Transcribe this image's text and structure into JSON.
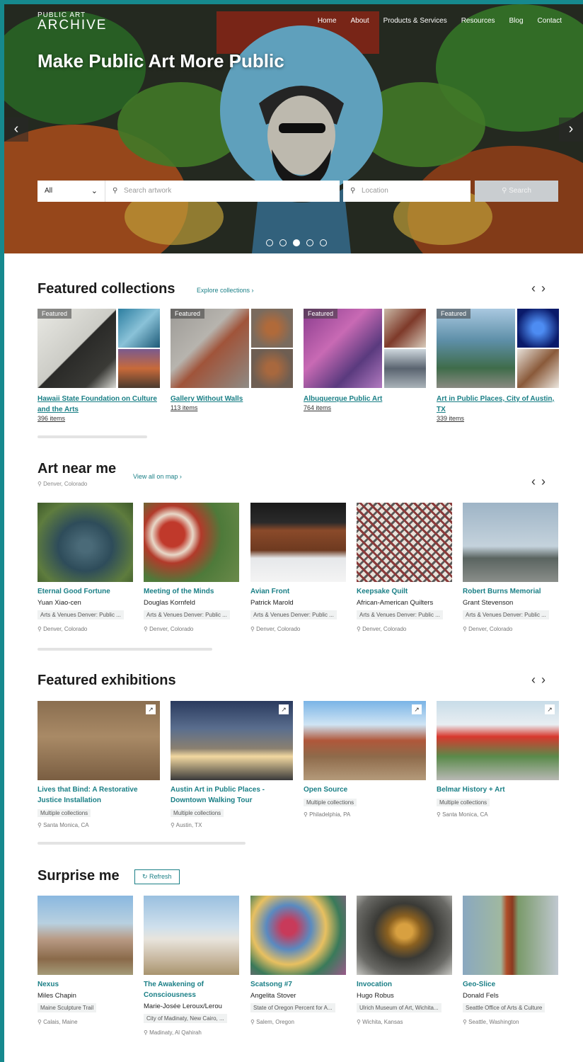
{
  "header": {
    "logo_top": "PUBLIC ART",
    "logo_bottom": "ARCHIVE",
    "nav": [
      "Home",
      "About",
      "Products & Services",
      "Resources",
      "Blog",
      "Contact"
    ]
  },
  "hero": {
    "title": "Make Public Art More Public",
    "category_value": "All",
    "search_placeholder": "Search artwork",
    "location_placeholder": "Location",
    "search_button": "Search",
    "slide_count": 5,
    "active_slide": 3
  },
  "featured_collections": {
    "title": "Featured collections",
    "link": "Explore collections ›",
    "tag": "Featured",
    "items": [
      {
        "name": "Hawaii State Foundation on Culture and the Arts",
        "count": "396 items"
      },
      {
        "name": "Gallery Without Walls",
        "count": "113 items"
      },
      {
        "name": "Albuquerque Public Art",
        "count": "764 items"
      },
      {
        "name": "Art in Public Places, City of Austin, TX",
        "count": "339 items"
      }
    ]
  },
  "art_near_me": {
    "title": "Art near me",
    "location": "Denver, Colorado",
    "link": "View all on map ›",
    "items": [
      {
        "title": "Eternal Good Fortune",
        "artist": "Yuan Xiao-cen",
        "collection": "Arts & Venues Denver: Public ...",
        "location": "Denver, Colorado"
      },
      {
        "title": "Meeting of the Minds",
        "artist": "Douglas Kornfeld",
        "collection": "Arts & Venues Denver: Public ...",
        "location": "Denver, Colorado"
      },
      {
        "title": "Avian Front",
        "artist": "Patrick Marold",
        "collection": "Arts & Venues Denver: Public ...",
        "location": "Denver, Colorado"
      },
      {
        "title": "Keepsake Quilt",
        "artist": "African-American Quilters",
        "collection": "Arts & Venues Denver: Public ...",
        "location": "Denver, Colorado"
      },
      {
        "title": "Robert Burns Memorial",
        "artist": "Grant Stevenson",
        "collection": "Arts & Venues Denver: Public ...",
        "location": "Denver, Colorado"
      }
    ]
  },
  "featured_exhibitions": {
    "title": "Featured exhibitions",
    "items": [
      {
        "title": "Lives that Bind: A Restorative Justice Installation",
        "collection": "Multiple collections",
        "location": "Santa Monica, CA"
      },
      {
        "title": "Austin Art in Public Places - Downtown Walking Tour",
        "collection": "Multiple collections",
        "location": "Austin, TX"
      },
      {
        "title": "Open Source",
        "collection": "Multiple collections",
        "location": "Philadelphia, PA"
      },
      {
        "title": "Belmar History + Art",
        "collection": "Multiple collections",
        "location": "Santa Monica, CA"
      }
    ]
  },
  "surprise_me": {
    "title": "Surprise me",
    "refresh": "Refresh",
    "items": [
      {
        "title": "Nexus",
        "artist": "Miles Chapin",
        "collection": "Maine Sculpture Trail",
        "location": "Calais, Maine"
      },
      {
        "title": "The Awakening of Consciousness",
        "artist": "Marie-Josée Leroux/Lerou",
        "collection": "City of Madinaty, New Cairo, ...",
        "location": "Madinaty, Al Qahirah"
      },
      {
        "title": "Scatsong #7",
        "artist": "Angelita Stover",
        "collection": "State of Oregon Percent for A...",
        "location": "Salem, Oregon"
      },
      {
        "title": "Invocation",
        "artist": "Hugo Robus",
        "collection": "Ulrich Museum of Art, Wichita...",
        "location": "Wichita, Kansas"
      },
      {
        "title": "Geo-Slice",
        "artist": "Donald Fels",
        "collection": "Seattle Office of Arts & Culture",
        "location": "Seattle, Washington"
      }
    ]
  },
  "colors": {
    "accent": "#1a7f86",
    "frame": "#16898e"
  }
}
